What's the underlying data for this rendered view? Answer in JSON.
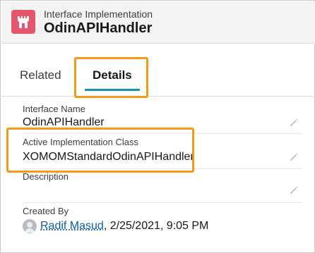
{
  "header": {
    "object_type": "Interface Implementation",
    "record_title": "OdinAPIHandler",
    "icon": "castle-icon",
    "icon_color": "#e3566b"
  },
  "tabs": [
    {
      "label": "Related",
      "active": false
    },
    {
      "label": "Details",
      "active": true
    }
  ],
  "fields": {
    "interface_name": {
      "label": "Interface Name",
      "value": "OdinAPIHandler"
    },
    "active_class": {
      "label": "Active Implementation Class",
      "value": "XOMOMStandardOdinAPIHandler"
    },
    "description": {
      "label": "Description",
      "value": ""
    },
    "created_by": {
      "label": "Created By",
      "user": "Radif Masud",
      "timestamp": ", 2/25/2021, 9:05 PM"
    }
  },
  "colors": {
    "highlight": "#f49a17",
    "tab_active": "#1b96a8",
    "link": "#0b5cab"
  }
}
